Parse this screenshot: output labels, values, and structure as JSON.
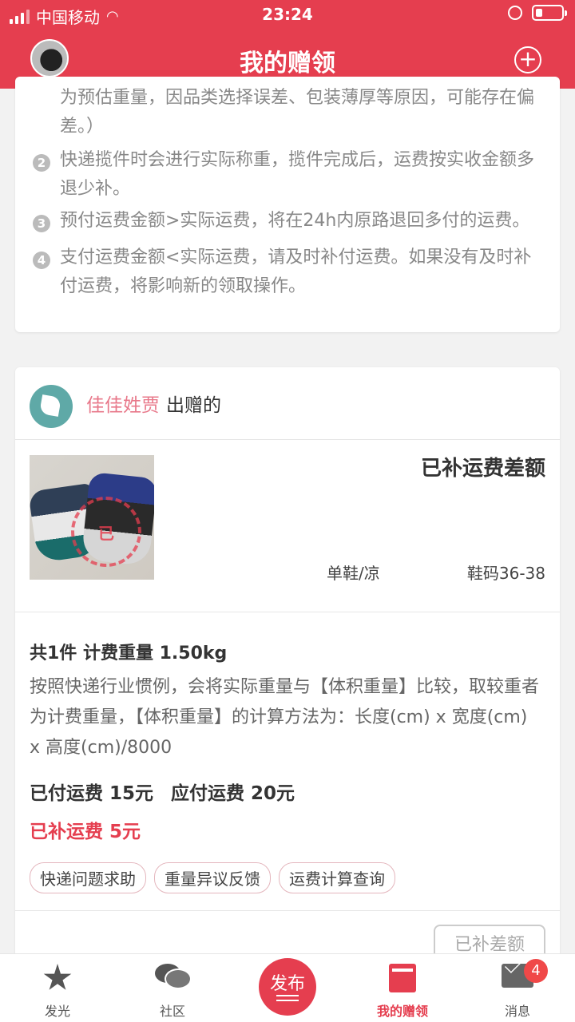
{
  "status_bar": {
    "carrier": "中国移动",
    "time": "23:24"
  },
  "header": {
    "title": "我的赠领"
  },
  "notes": {
    "lines": [
      "为预估重量，因品类选择误差、包装薄厚等原因，可能存在偏",
      "差。）",
      "快递揽件时会进行实际称重，揽件完成后，运费按实收金额多",
      "退少补。",
      "预付运费金额>实际运费，将在24h内原路退回多付的运费。",
      "支付运费金额<实际运费，请及时补付运费。如果没有及时补",
      "付运费，将影响新的领取操作。"
    ],
    "numbers": [
      "2",
      "3",
      "4"
    ]
  },
  "order": {
    "donor_name": "佳佳姓贾",
    "donor_suffix": "出赠的",
    "status": "已补运费差额",
    "stamp_text": "已",
    "category": "单鞋/凉",
    "size": "鞋码36-38",
    "summary": "共1件 计费重量 1.50kg",
    "description": "按照快递行业惯例，会将实际重量与【体积重量】比较，取较重者为计费重量，【体积重量】的计算方法为：长度(cm) x 宽度(cm) x 高度(cm)/8000",
    "paid_fee": "已付运费 15元",
    "due_fee": "应付运费 20元",
    "extra_fee": "已补运费 5元",
    "tags": [
      "快递问题求助",
      "重量异议反馈",
      "运费计算查询"
    ],
    "action_button": "已补差额"
  },
  "tabbar": {
    "items": [
      {
        "label": "发光",
        "icon": "star-icon"
      },
      {
        "label": "社区",
        "icon": "chat-icon"
      },
      {
        "label": "发布",
        "icon": "publish-icon"
      },
      {
        "label": "我的赠领",
        "icon": "book-icon"
      },
      {
        "label": "消息",
        "icon": "mail-icon"
      }
    ],
    "message_badge": "4"
  },
  "colors": {
    "brand": "#e53e4f",
    "donor_name": "#e8788a"
  }
}
